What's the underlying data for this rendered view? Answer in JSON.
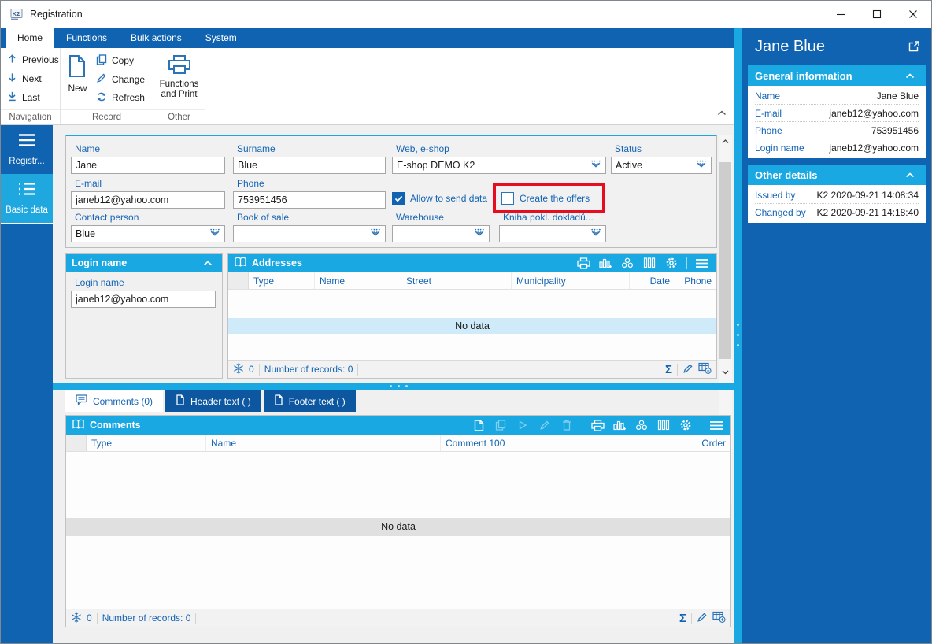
{
  "window": {
    "title": "Registration"
  },
  "ribbon": {
    "tabs": [
      {
        "label": "Home",
        "active": true
      },
      {
        "label": "Functions",
        "active": false
      },
      {
        "label": "Bulk actions",
        "active": false
      },
      {
        "label": "System",
        "active": false
      }
    ],
    "navigation": {
      "label": "Navigation",
      "items": [
        "Previous",
        "Next",
        "Last"
      ]
    },
    "record": {
      "label": "Record",
      "new_label": "New",
      "items": [
        "Copy",
        "Change",
        "Refresh"
      ]
    },
    "other": {
      "label": "Other",
      "functions_print_label": "Functions and Print"
    }
  },
  "sidebar": {
    "items": [
      {
        "label": "Registr...",
        "active": false
      },
      {
        "label": "Basic data",
        "active": true
      }
    ]
  },
  "form": {
    "name": {
      "label": "Name",
      "value": "Jane"
    },
    "surname": {
      "label": "Surname",
      "value": "Blue"
    },
    "web_eshop": {
      "label": "Web, e-shop",
      "value": "E-shop DEMO K2"
    },
    "status": {
      "label": "Status",
      "value": "Active"
    },
    "email": {
      "label": "E-mail",
      "value": "janeb12@yahoo.com"
    },
    "phone": {
      "label": "Phone",
      "value": "753951456"
    },
    "allow_send": {
      "label": "Allow to send data",
      "checked": true
    },
    "create_offers": {
      "label": "Create the offers",
      "checked": false,
      "highlighted": true
    },
    "contact_person": {
      "label": "Contact person",
      "value": "Blue"
    },
    "book_of_sale": {
      "label": "Book of sale",
      "value": ""
    },
    "warehouse": {
      "label": "Warehouse",
      "value": ""
    },
    "kniha": {
      "label": "Kniha pokl. dokladů...",
      "value": ""
    }
  },
  "login_panel": {
    "title": "Login name",
    "field_label": "Login name",
    "value": "janeb12@yahoo.com"
  },
  "addresses": {
    "title": "Addresses",
    "columns": [
      "Type",
      "Name",
      "Street",
      "Municipality",
      "Date",
      "Phone"
    ],
    "empty_text": "No data",
    "footer": {
      "count": "0",
      "records": "Number of records: 0"
    }
  },
  "detail_tabs": [
    {
      "label": "Comments (0)",
      "active": true
    },
    {
      "label": "Header text ( )",
      "active": false
    },
    {
      "label": "Footer text ( )",
      "active": false
    }
  ],
  "comments": {
    "title": "Comments",
    "columns": [
      "Type",
      "Name",
      "Comment 100",
      "Order"
    ],
    "empty_text": "No data",
    "footer": {
      "count": "0",
      "records": "Number of records: 0"
    }
  },
  "right_panel": {
    "title": "Jane Blue",
    "general": {
      "title": "General information",
      "rows": [
        {
          "label": "Name",
          "value": "Jane Blue"
        },
        {
          "label": "E-mail",
          "value": "janeb12@yahoo.com"
        },
        {
          "label": "Phone",
          "value": "753951456"
        },
        {
          "label": "Login name",
          "value": "janeb12@yahoo.com"
        }
      ]
    },
    "other": {
      "title": "Other details",
      "rows": [
        {
          "label": "Issued by",
          "value": "K2 2020-09-21 14:08:34"
        },
        {
          "label": "Changed by",
          "value": "K2 2020-09-21 14:18:40"
        }
      ]
    }
  },
  "icons": {
    "sigma": "Σ"
  },
  "colors": {
    "accent_blue": "#0f63b0",
    "header_cyan": "#19a8e2",
    "highlight_red": "#e60d20",
    "row_highlight_blue": "#cfeaf8",
    "row_highlight_gray": "#e0e0e0"
  }
}
